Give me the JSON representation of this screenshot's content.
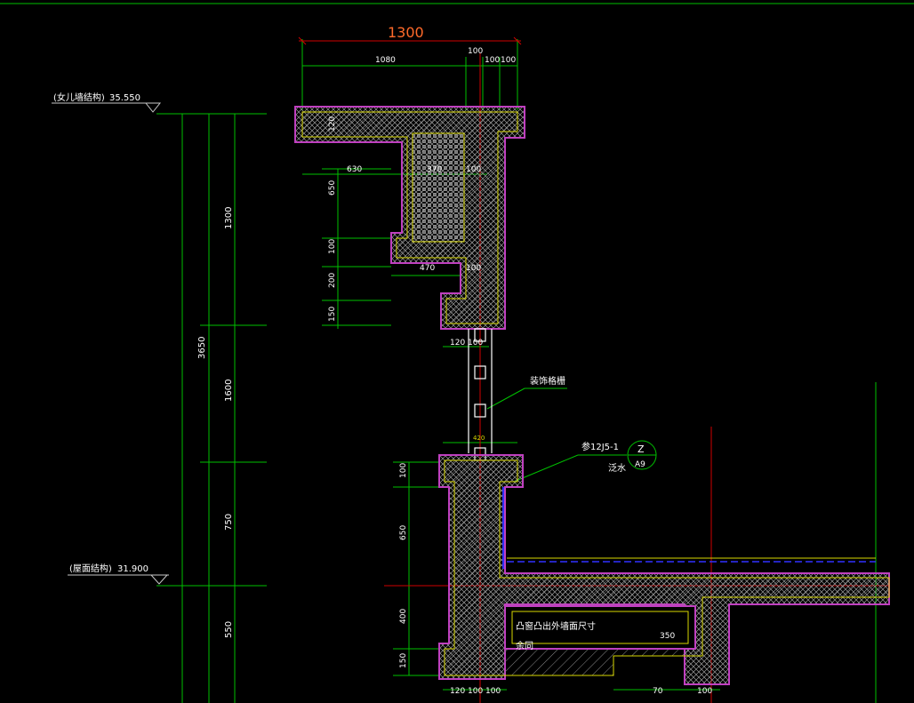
{
  "drawing": {
    "title": "",
    "elevations": [
      {
        "label": "(女儿墙结构)",
        "value": "35.550"
      },
      {
        "label": "(屋面结构)",
        "value": "31.900"
      }
    ],
    "top_dims": {
      "total": "1300",
      "seg_a": "1080",
      "seg_b": "100",
      "seg_c": "100",
      "seg_d": "100"
    },
    "vertical_dims": {
      "total": "3650",
      "d1": "1300",
      "d2": "1600",
      "d3": "750",
      "d4": "550"
    },
    "left_dims": {
      "a": "650",
      "b": "100",
      "c": "200",
      "d": "150",
      "e": "100",
      "f": "650",
      "g": "400",
      "h": "150"
    },
    "inner_dims": {
      "d120": "120",
      "d630": "630",
      "d370": "370",
      "d100a": "100",
      "d470": "470",
      "d100b": "100",
      "d120b": "120",
      "d100c": "100",
      "d420": "420",
      "d120c": "120",
      "d100d": "100",
      "d100e": "100",
      "d350": "350",
      "d70": "70",
      "d100f": "100"
    },
    "annotations": {
      "grille": "装饰格栅",
      "ref_code": "参12J5-1",
      "ref_sub": "泛水",
      "bubble_top": "Z",
      "bubble_bottom": "A9",
      "bay_note": "凸窗凸出外墙面尺寸",
      "bay_note2": "余同"
    }
  }
}
